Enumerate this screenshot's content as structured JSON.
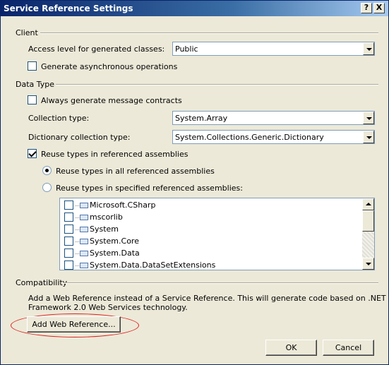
{
  "window": {
    "title": "Service Reference Settings",
    "help_button": "?",
    "close_button": "X"
  },
  "client": {
    "group_label": "Client",
    "access_level_label": "Access level for generated classes:",
    "access_level_value": "Public",
    "async_label": "Generate asynchronous operations",
    "async_checked": false
  },
  "data_type": {
    "group_label": "Data Type",
    "always_generate_label": "Always generate message contracts",
    "always_generate_checked": false,
    "collection_type_label": "Collection type:",
    "collection_type_value": "System.Array",
    "dictionary_type_label": "Dictionary collection type:",
    "dictionary_type_value": "System.Collections.Generic.Dictionary",
    "reuse_types_label": "Reuse types in referenced assemblies",
    "reuse_types_checked": true,
    "reuse_all_label": "Reuse types in all referenced assemblies",
    "reuse_specified_label": "Reuse types in specified referenced assemblies:",
    "selected_option": "all",
    "assemblies": [
      "Microsoft.CSharp",
      "mscorlib",
      "System",
      "System.Core",
      "System.Data",
      "System.Data.DataSetExtensions"
    ]
  },
  "compatibility": {
    "group_label": "Compatibility",
    "description_line1": "Add a Web Reference instead of a Service Reference. This will generate code based on .NET",
    "description_line2": "Framework 2.0 Web Services technology.",
    "add_web_reference_button": "Add Web Reference..."
  },
  "footer": {
    "ok_button": "OK",
    "cancel_button": "Cancel"
  },
  "colors": {
    "titlebar_start": "#0a246a",
    "dialog_bg": "#ece9d8",
    "highlight_ellipse": "#e02020"
  }
}
